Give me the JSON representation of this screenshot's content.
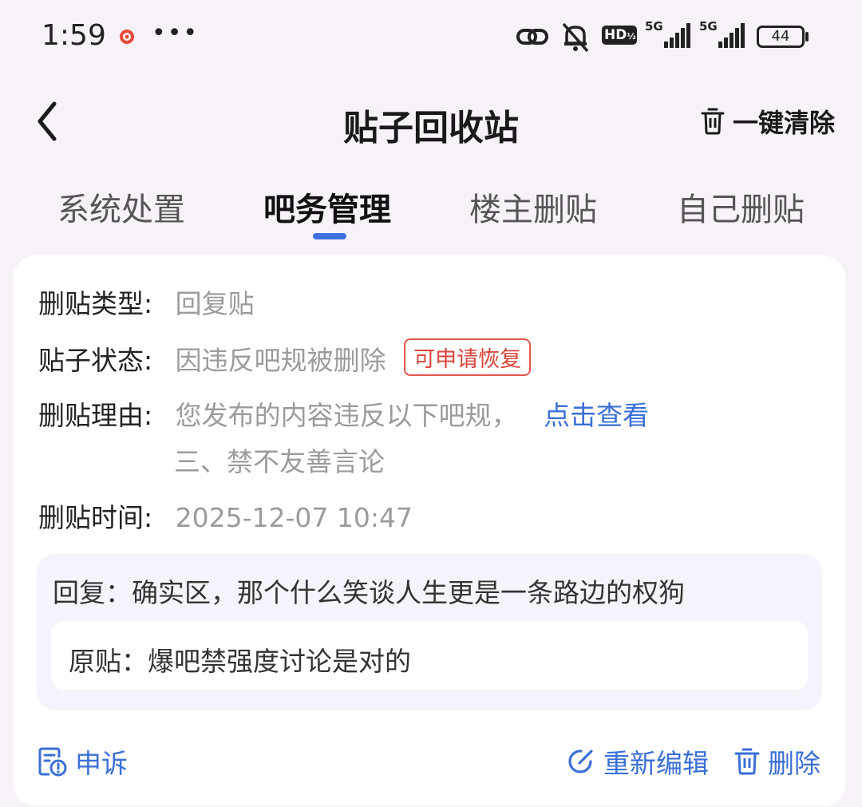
{
  "status_bar": {
    "time": "1:59",
    "more": "•••",
    "network_1": "5G",
    "network_2": "5G",
    "battery": "44",
    "hd_label": "HD"
  },
  "nav": {
    "title": "贴子回收站",
    "clear_all_label": "一键清除"
  },
  "tabs": [
    {
      "label": "系统处置",
      "active": false
    },
    {
      "label": "吧务管理",
      "active": true
    },
    {
      "label": "楼主删贴",
      "active": false
    },
    {
      "label": "自己删贴",
      "active": false
    }
  ],
  "record": {
    "type_label": "删贴类型:",
    "type_value": "回复贴",
    "status_label": "贴子状态:",
    "status_value": "因违反吧规被删除",
    "status_badge": "可申请恢复",
    "reason_label": "删贴理由:",
    "reason_value": "您发布的内容违反以下吧规，",
    "reason_link": "点击查看",
    "reason_rule": "三、禁不友善言论",
    "time_label": "删贴时间:",
    "time_value": "2025-12-07 10:47",
    "reply_text": "回复：确实区，那个什么笑谈人生更是一条路边的权狗",
    "origin_text": "原贴：爆吧禁强度讨论是对的"
  },
  "actions": {
    "appeal": "申诉",
    "reedit": "重新编辑",
    "delete": "删除"
  },
  "colors": {
    "accent": "#3b6fd6",
    "badge_red": "#d9463b",
    "tab_indicator": "#3e6ee0",
    "page_bg": "#f6f2f8"
  }
}
